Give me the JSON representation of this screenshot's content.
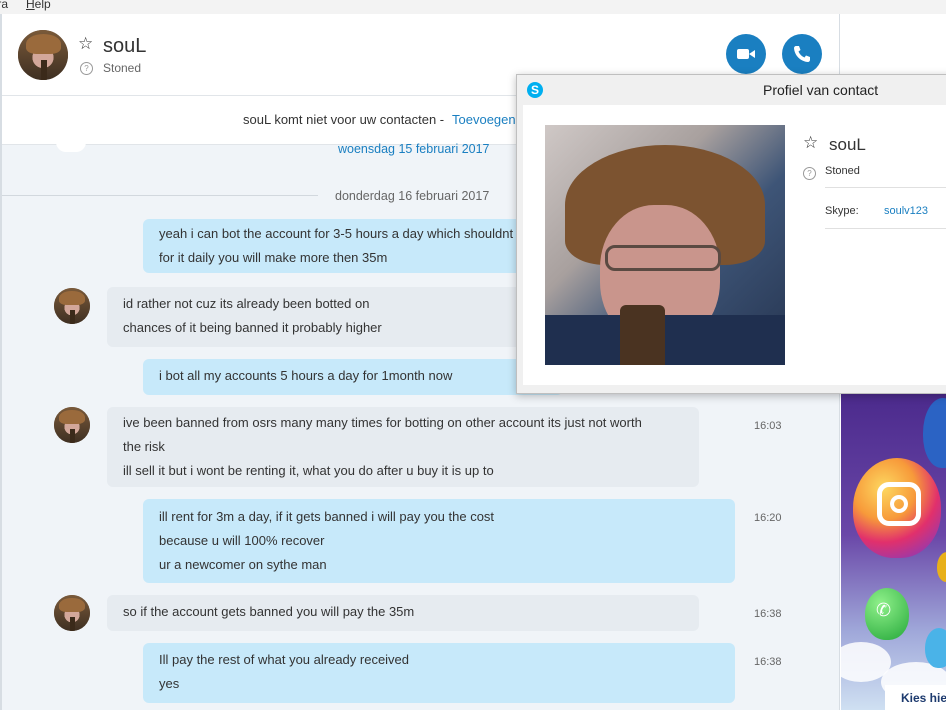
{
  "menu": {
    "items": [
      "tra",
      "Help"
    ]
  },
  "header": {
    "contact_name": "souL",
    "mood": "Stoned",
    "icons": {
      "favorite": "star-icon",
      "status": "question-mark-icon",
      "video": "video-camera-icon",
      "call": "phone-icon"
    }
  },
  "notice": {
    "text": "souL komt niet voor uw contacten - ",
    "link": "Toevoegen"
  },
  "date_separators": [
    "woensdag 15 februari 2017",
    "donderdag 16 februari 2017"
  ],
  "messages": [
    {
      "direction": "out",
      "lines": [
        "yeah i can bot the account for 3-5 hours a day which shouldnt",
        "for it daily you will make more then 35m"
      ],
      "time": ""
    },
    {
      "direction": "in",
      "lines": [
        "id rather not cuz its already been botted on",
        "chances of it being banned it probably higher"
      ],
      "time": ""
    },
    {
      "direction": "out",
      "lines": [
        "i bot all my accounts 5 hours a day for 1month now"
      ],
      "time": ""
    },
    {
      "direction": "in",
      "lines": [
        "ive been banned from osrs many many times for botting on other account its just not worth",
        "the risk",
        "ill sell it but i wont be renting it, what you do after u buy it is up to"
      ],
      "time": "16:03"
    },
    {
      "direction": "out",
      "lines": [
        "ill rent for 3m a day, if it gets banned i will pay you the cost",
        "because u will 100% recover",
        "ur a newcomer on sythe man"
      ],
      "time": "16:20"
    },
    {
      "direction": "in",
      "lines": [
        "so if the account gets banned you will pay the 35m"
      ],
      "time": "16:38"
    },
    {
      "direction": "out",
      "lines": [
        "Ill pay the rest of what you already received",
        "yes"
      ],
      "time": "16:38"
    }
  ],
  "profile_popup": {
    "title": "Profiel van contact",
    "name": "souL",
    "mood": "Stoned",
    "skype_label": "Skype:",
    "skype_value": "soulv123"
  },
  "ad": {
    "cta": "Kies hie"
  },
  "colors": {
    "accent": "#1a7fc1",
    "outgoing_bubble": "#c7e9fa",
    "incoming_bubble": "#e6ebf0",
    "skype_blue": "#00aff0"
  }
}
